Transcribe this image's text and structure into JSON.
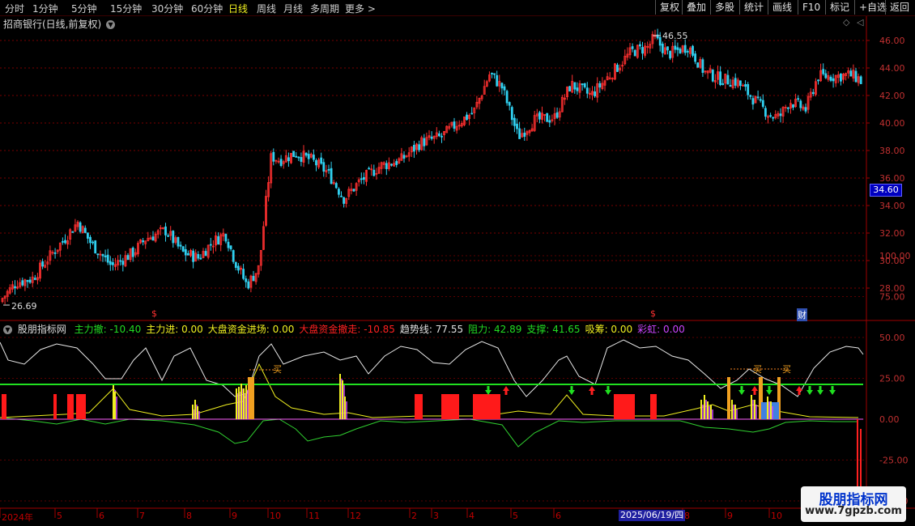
{
  "toolbar": {
    "periods": [
      "分时",
      "1分钟",
      "5分钟",
      "15分钟",
      "30分钟",
      "60分钟",
      "日线",
      "周线",
      "月线",
      "多周期",
      "更多 >"
    ],
    "active_period": "日线",
    "buttons": [
      "复权",
      "叠加",
      "多股",
      "统计",
      "画线",
      "F10",
      "标记",
      "+自选",
      "返回"
    ]
  },
  "stock": {
    "title": "招商银行(日线,前复权)",
    "high_label": "46.55",
    "low_label": "26.69",
    "current_price": "34.60",
    "marker_dollar": "$",
    "marker_cai": "财"
  },
  "price_axis": [
    "46.00",
    "44.00",
    "42.00",
    "40.00",
    "38.00",
    "36.00",
    "34.00",
    "32.00",
    "30.00",
    "28.00"
  ],
  "indicator": {
    "name": "股朋指标网",
    "items": [
      {
        "label": "主力撤: -10.40",
        "color": "#22dd22"
      },
      {
        "label": "主力进: 0.00",
        "color": "#f0f020"
      },
      {
        "label": "大盘资金进场: 0.00",
        "color": "#f0f020"
      },
      {
        "label": "大盘资金撤走: -10.85",
        "color": "#ff2020"
      },
      {
        "label": "趋势线: 77.55",
        "color": "#e0e0e0"
      },
      {
        "label": "阻力: 42.89",
        "color": "#22dd22"
      },
      {
        "label": "支撑: 41.65",
        "color": "#22dd22"
      },
      {
        "label": "吸筹: 0.00",
        "color": "#f0f020"
      },
      {
        "label": "彩虹: 0.00",
        "color": "#cc44ff"
      }
    ],
    "axis": [
      "100.00",
      "75.00",
      "50.00",
      "25.00",
      "0.00",
      "-25.00",
      "-50.00"
    ],
    "buy_label": "买"
  },
  "time_axis": [
    "2024年",
    "5",
    "6",
    "7",
    "8",
    "9",
    "10",
    "11",
    "12",
    "2",
    "3",
    "4",
    "5",
    "6",
    "2025/06/19/四",
    "8",
    "9",
    "10"
  ],
  "watermark": {
    "title": "股朋指标网",
    "url": "www.7gpzb.com"
  }
}
